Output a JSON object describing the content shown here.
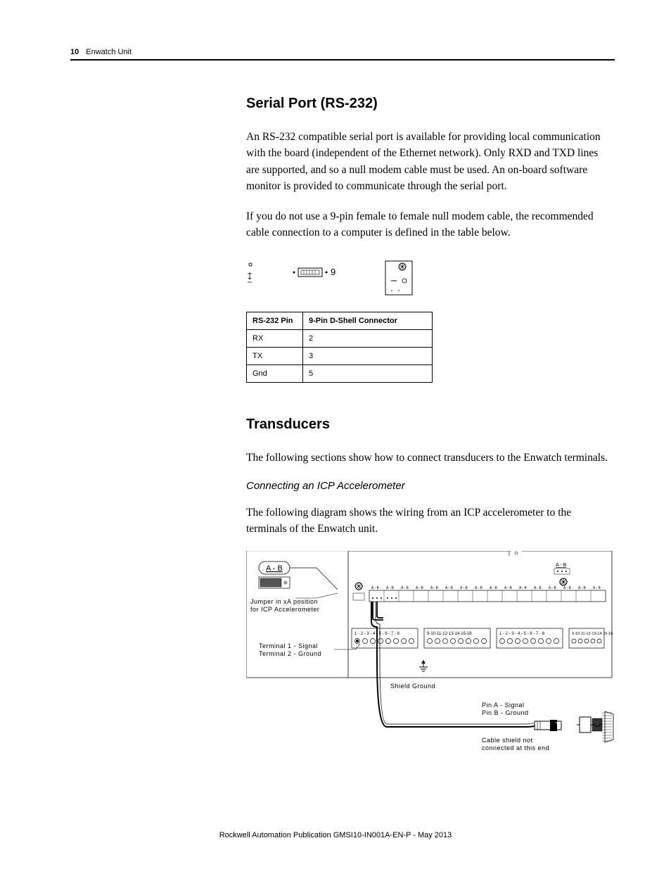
{
  "header": {
    "page": "10",
    "title": "Enwatch Unit"
  },
  "section1": {
    "heading": "Serial Port (RS-232)",
    "p1": "An RS-232 compatible serial port is available for providing local communication with the board (independent of the Ethernet network). Only RXD and TXD lines are supported, and so a null modem cable must be used. An on-board software monitor is provided to communicate through the serial port.",
    "p2": "If you do not use a 9-pin female to female null modem cable, the recommended cable connection to a computer is defined in the table below."
  },
  "diagram1": {
    "pinLabel": "9"
  },
  "table": {
    "h1": "RS-232 Pin",
    "h2": "9-Pin D-Shell Connector",
    "r1c1": "RX",
    "r1c2": "2",
    "r2c1": "TX",
    "r2c2": "3",
    "r3c1": "Gnd",
    "r3c2": "5"
  },
  "section2": {
    "heading": "Transducers",
    "p1": "The following sections show how to connect transducers to the Enwatch terminals.",
    "sub": "Connecting an ICP Accelerometer",
    "p2": "The following diagram shows the wiring from an ICP accelerometer to the terminals of the Enwatch unit."
  },
  "wiring": {
    "abLabel": "A - B",
    "jumperLine1": "Jumper in xA position",
    "jumperLine2": "for ICP Accelerometer",
    "termLine1": "Terminal 1 - Signal",
    "termLine2": "Terminal 2 - Ground",
    "shieldGround": "Shield Ground",
    "pinA": "Pin A - Signal",
    "pinB": "Pin B - Ground",
    "cableNote1": "Cable shield not",
    "cableNote2": "connected at this end",
    "abSmall": "A - B",
    "blockLabels1": "1 - 2 - 3 - 4 - 5 - 6 - 7 - 8",
    "blockLabels2": "9-10-11-12-13-14-15-16"
  },
  "footer": "Rockwell Automation Publication GMSI10-IN001A-EN-P - May 2013"
}
